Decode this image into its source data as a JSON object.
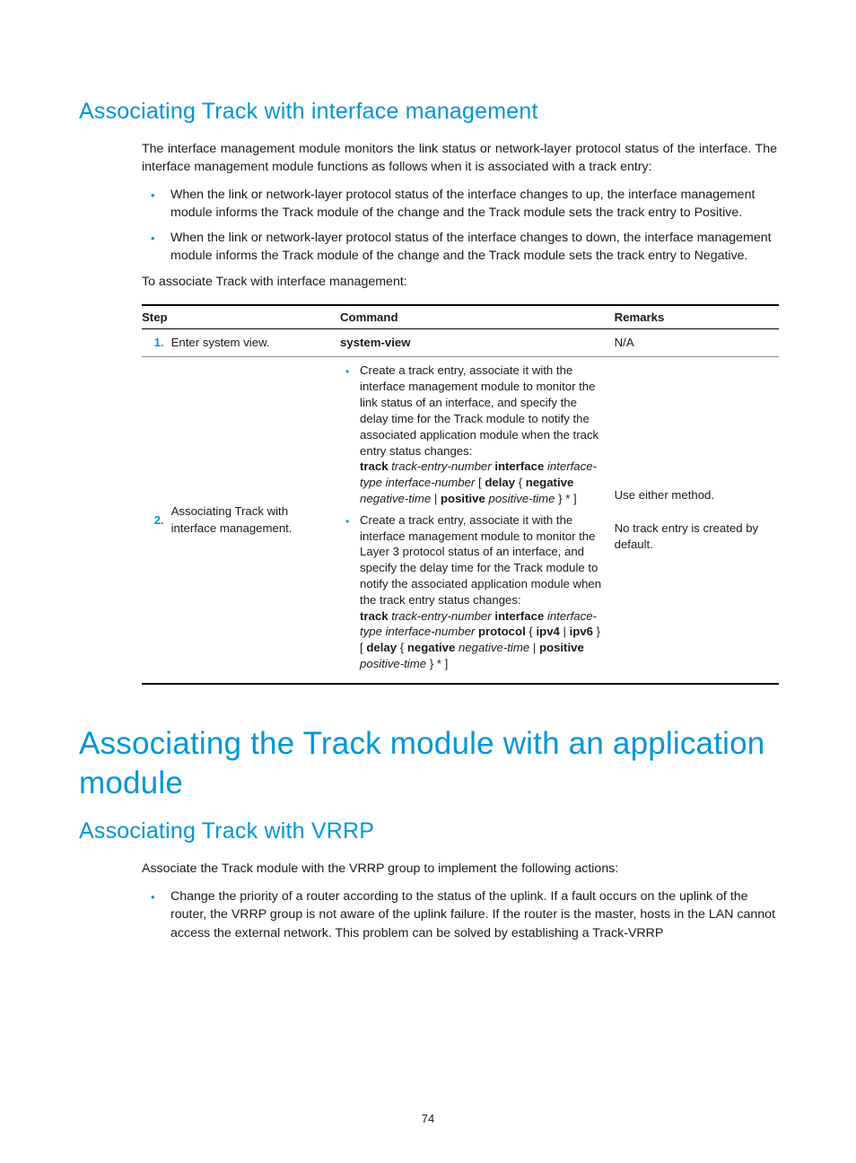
{
  "section1": {
    "title": "Associating Track with interface management",
    "intro": "The interface management module monitors the link status or network-layer protocol status of the interface. The interface management module functions as follows when it is associated with a track entry:",
    "bullets": [
      "When the link or network-layer protocol status of the interface changes to up, the interface management module informs the Track module of the change and the Track module sets the track entry to Positive.",
      "When the link or network-layer protocol status of the interface changes to down, the interface management module informs the Track module of the change and the Track module sets the track entry to Negative."
    ],
    "lead": "To associate Track with interface management:"
  },
  "table": {
    "headers": {
      "step": "Step",
      "command": "Command",
      "remarks": "Remarks"
    },
    "row1": {
      "num": "1.",
      "desc": "Enter system view.",
      "cmd": "system-view",
      "remarks": "N/A"
    },
    "row2": {
      "num": "2.",
      "desc": "Associating Track with interface management.",
      "bullet1_text": "Create a track entry, associate it with the interface management module to monitor the link status of an interface, and specify the delay time for the Track module to notify the associated application module when the track entry status changes:",
      "bullet2_text": "Create a track entry, associate it with the interface management module to monitor the Layer 3 protocol status of an interface, and specify the delay time for the Track module to notify the associated application module when the track entry status changes:",
      "remarks1": "Use either method.",
      "remarks2": "No track entry is created by default."
    }
  },
  "section2": {
    "title": "Associating the Track module with an application module",
    "sub": "Associating Track with VRRP",
    "intro": "Associate the Track module with the VRRP group to implement the following actions:",
    "bullet1": "Change the priority of a router according to the status of the uplink. If a fault occurs on the uplink of the router, the VRRP group is not aware of the uplink failure. If the router is the master, hosts in the LAN cannot access the external network. This problem can be solved by establishing a Track-VRRP"
  },
  "pagenum": "74"
}
